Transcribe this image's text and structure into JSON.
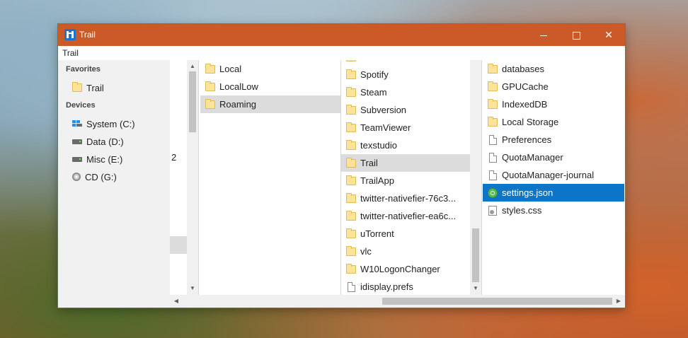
{
  "window": {
    "title": "Trail",
    "path": "Trail",
    "accent_color": "#cc5a28",
    "controls": {
      "minimize_icon": "minimize-icon",
      "maximize_icon": "maximize-icon",
      "close_icon": "close-icon",
      "close_glyph": "✕"
    }
  },
  "sidebar": {
    "favorites_header": "Favorites",
    "favorites": [
      {
        "label": "Trail",
        "icon": "folder-icon"
      }
    ],
    "devices_header": "Devices",
    "devices": [
      {
        "label": "System (C:)",
        "icon": "system-drive-icon"
      },
      {
        "label": "Data (D:)",
        "icon": "drive-icon"
      },
      {
        "label": "Misc (E:)",
        "icon": "drive-icon"
      },
      {
        "label": "CD (G:)",
        "icon": "cd-drive-icon"
      }
    ]
  },
  "partial_column": {
    "fragment": "2"
  },
  "column_appdata": {
    "items": [
      {
        "label": "Local",
        "icon": "folder-icon"
      },
      {
        "label": "LocalLow",
        "icon": "folder-icon"
      },
      {
        "label": "Roaming",
        "icon": "folder-icon",
        "selected": true
      }
    ]
  },
  "column_roaming": {
    "items": [
      {
        "label": "Spotify",
        "icon": "folder-icon"
      },
      {
        "label": "Steam",
        "icon": "folder-icon"
      },
      {
        "label": "Subversion",
        "icon": "folder-icon"
      },
      {
        "label": "TeamViewer",
        "icon": "folder-icon"
      },
      {
        "label": "texstudio",
        "icon": "folder-icon"
      },
      {
        "label": "Trail",
        "icon": "folder-icon",
        "selected": true
      },
      {
        "label": "TrailApp",
        "icon": "folder-icon"
      },
      {
        "label": "twitter-nativefier-76c3...",
        "icon": "folder-icon"
      },
      {
        "label": "twitter-nativefier-ea6c...",
        "icon": "folder-icon"
      },
      {
        "label": "uTorrent",
        "icon": "folder-icon"
      },
      {
        "label": "vlc",
        "icon": "folder-icon"
      },
      {
        "label": "W10LogonChanger",
        "icon": "folder-icon"
      },
      {
        "label": "idisplay.prefs",
        "icon": "file-icon"
      }
    ]
  },
  "column_trail": {
    "items": [
      {
        "label": "databases",
        "icon": "folder-icon"
      },
      {
        "label": "GPUCache",
        "icon": "folder-icon"
      },
      {
        "label": "IndexedDB",
        "icon": "folder-icon"
      },
      {
        "label": "Local Storage",
        "icon": "folder-icon"
      },
      {
        "label": "Preferences",
        "icon": "file-icon"
      },
      {
        "label": "QuotaManager",
        "icon": "file-icon"
      },
      {
        "label": "QuotaManager-journal",
        "icon": "file-icon"
      },
      {
        "label": "settings.json",
        "icon": "json-file-icon",
        "selected": true
      },
      {
        "label": "styles.css",
        "icon": "css-file-icon"
      }
    ]
  },
  "colors": {
    "selection_blue": "#0d75c8",
    "selection_grey": "#dcdcdc",
    "folder": "#fce39a"
  }
}
